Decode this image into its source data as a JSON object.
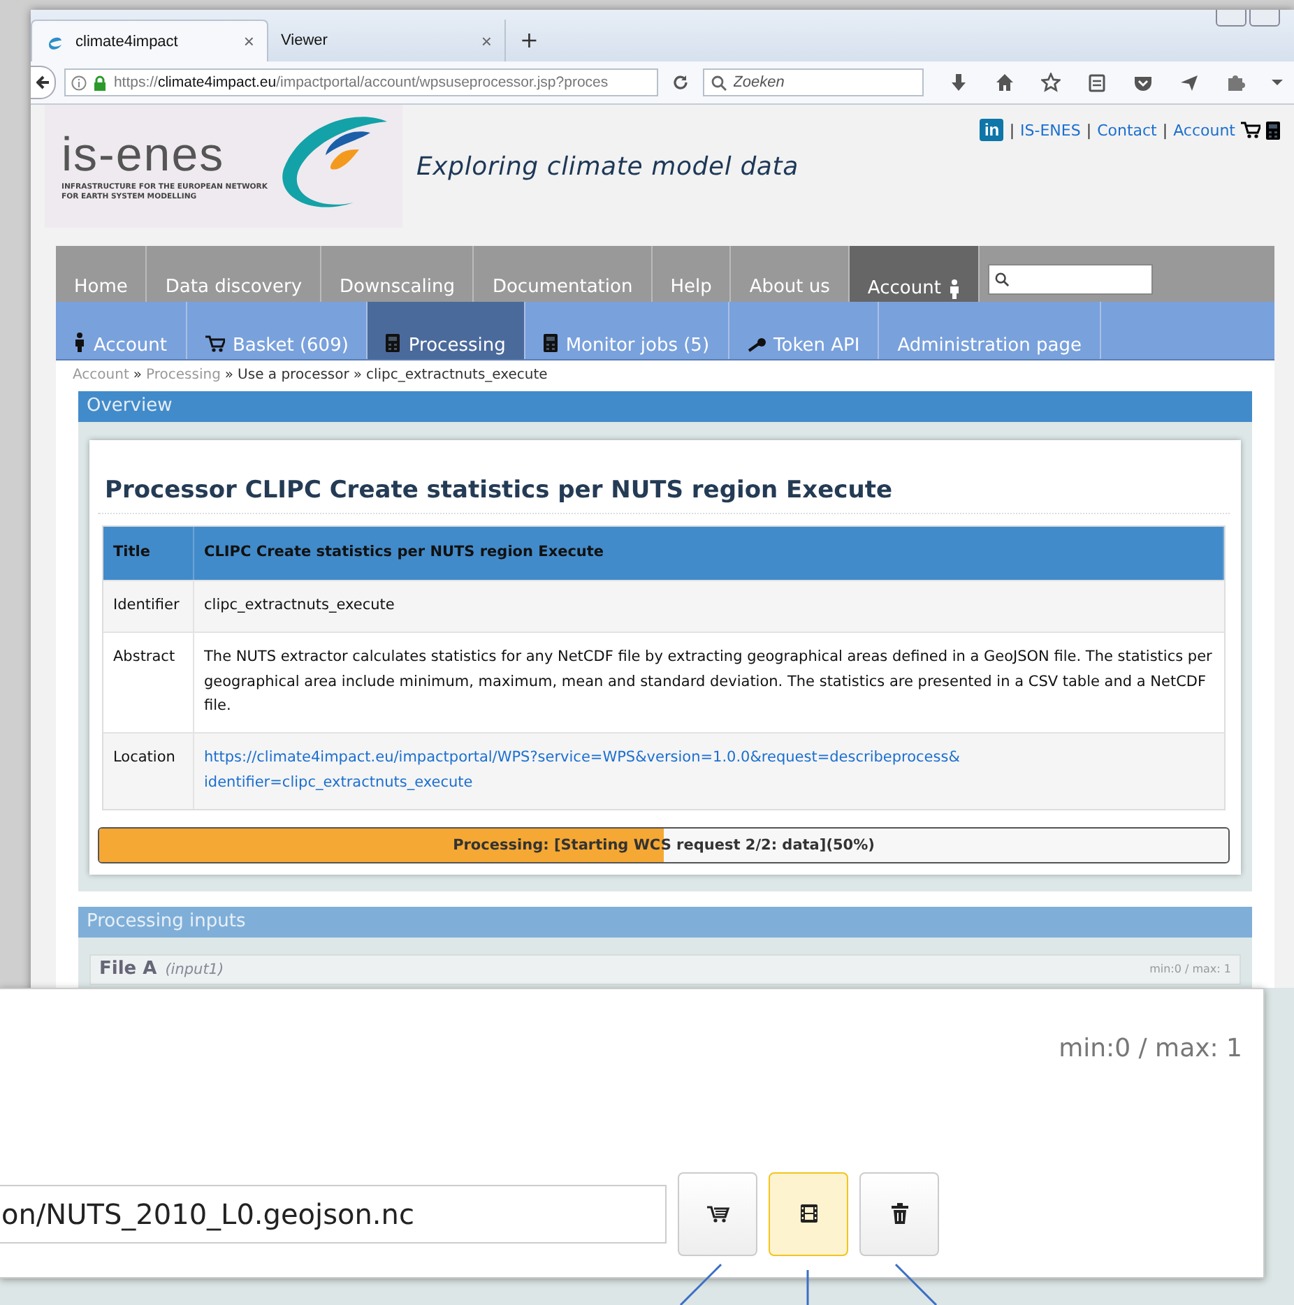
{
  "browser": {
    "tabs": [
      {
        "title": "climate4impact",
        "close": "×",
        "selected": true
      },
      {
        "title": "Viewer",
        "close": "×",
        "selected": false
      }
    ],
    "new_tab": "+",
    "url": {
      "scheme": "https://",
      "domain": "climate4impact.eu",
      "path": "/impactportal/account/wpsuseprocessor.jsp?proces"
    },
    "search": {
      "placeholder": "Zoeken"
    }
  },
  "site": {
    "logo": {
      "name": "is-enes",
      "subtitle": [
        "INFRASTRUCTURE FOR THE EUROPEAN NETWORK",
        "FOR EARTH SYSTEM MODELLING"
      ]
    },
    "tagline": "Exploring climate model data",
    "top_links": [
      {
        "kind": "linkedin",
        "text": "in"
      },
      {
        "kind": "separator",
        "text": "|"
      },
      {
        "kind": "link",
        "text": "IS-ENES"
      },
      {
        "kind": "separator",
        "text": "|"
      },
      {
        "kind": "link",
        "text": "Contact"
      },
      {
        "kind": "separator",
        "text": "|"
      },
      {
        "kind": "link",
        "text": "Account"
      }
    ],
    "main_nav": [
      {
        "label": "Home",
        "selected": false
      },
      {
        "label": "Data discovery",
        "selected": false
      },
      {
        "label": "Downscaling",
        "selected": false
      },
      {
        "label": "Documentation",
        "selected": false
      },
      {
        "label": "Help",
        "selected": false
      },
      {
        "label": "About us",
        "selected": false
      },
      {
        "label": "Account",
        "selected": true
      }
    ],
    "sub_nav": [
      {
        "label": "Account",
        "kind": "person",
        "selected": false
      },
      {
        "label": "Basket (609)",
        "kind": "cart",
        "selected": false
      },
      {
        "label": "Processing",
        "kind": "calculator",
        "selected": true
      },
      {
        "label": "Monitor jobs (5)",
        "kind": "calculator",
        "selected": false
      },
      {
        "label": "Token API",
        "kind": "key",
        "selected": false
      },
      {
        "label": "Administration page",
        "kind": "plain",
        "selected": false
      }
    ],
    "breadcrumb": [
      {
        "text": "Account",
        "link": true
      },
      {
        "separator": "»",
        "text": "Processing",
        "link": true
      },
      {
        "separator": "»",
        "text": "Use a processor",
        "link": false
      },
      {
        "separator": "»",
        "text": "clipc_extractnuts_execute",
        "link": false
      }
    ]
  },
  "overview": {
    "header": "Overview",
    "heading": "Processor CLIPC Create statistics per NUTS region Execute",
    "table": {
      "columns": [
        "Title",
        "CLIPC Create statistics per NUTS region Execute"
      ],
      "rows": [
        {
          "label": "Identifier",
          "kind": "text",
          "lines": [
            "clipc_extractnuts_execute"
          ]
        },
        {
          "label": "Abstract",
          "kind": "text",
          "lines": [
            "The NUTS extractor calculates statistics for any NetCDF file by extracting geographical areas defined in a GeoJSON file. The statistics per geographical area include minimum, maximum, mean and standard deviation. The statistics are presented in a CSV table and a NetCDF file."
          ]
        },
        {
          "label": "Location",
          "kind": "link",
          "lines": [
            "https://climate4impact.eu/impactportal/WPS?service=WPS&version=1.0.0&request=describeprocess&",
            "identifier=clipc_extractnuts_execute"
          ]
        }
      ]
    },
    "progress": {
      "level": 0.5,
      "text": "Processing: [Starting WCS request 2/2: data](50%)"
    }
  },
  "inputs": {
    "header": "Processing inputs",
    "file": {
      "label": "File A",
      "id": "(input1)",
      "limits": "min:0 / max: 1"
    }
  },
  "inset": {
    "limits": "min:0 / max: 1",
    "value": "on/NUTS_2010_L0.geojson.nc",
    "buttons": [
      {
        "kind": "cart",
        "highlighted": false
      },
      {
        "kind": "film",
        "highlighted": true
      },
      {
        "kind": "trash",
        "highlighted": false
      }
    ]
  }
}
